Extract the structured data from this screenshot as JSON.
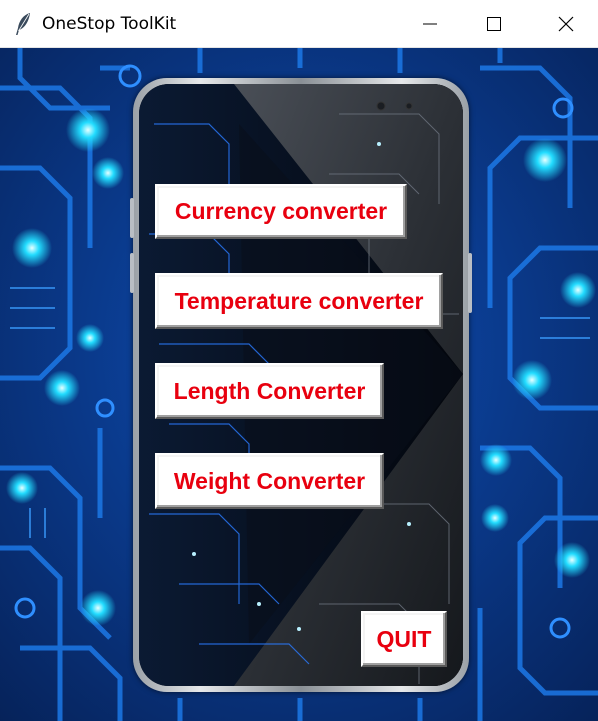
{
  "window": {
    "title": "OneStop ToolKit",
    "icon": "feather-icon",
    "controls": [
      "minimize-icon",
      "maximize-icon",
      "close-icon"
    ]
  },
  "menu": {
    "currency": "Currency converter",
    "temperature": "Temperature converter",
    "length": "Length Converter",
    "weight": "Weight Converter",
    "quit": "QUIT"
  },
  "colors": {
    "button_text": "#e8000f",
    "button_face": "#ffffff",
    "background_circuit": "#0b2f7a",
    "circuit_glow": "#18d4ff"
  }
}
